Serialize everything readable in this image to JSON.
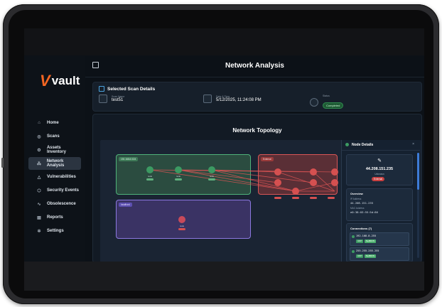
{
  "app": {
    "brand_mark": "V",
    "brand_word": "vault",
    "page_title": "Network Analysis"
  },
  "sidebar": {
    "items": [
      {
        "label": "Home",
        "icon": "home-icon",
        "glyph": "⌂"
      },
      {
        "label": "Scans",
        "icon": "scan-icon",
        "glyph": "◎"
      },
      {
        "label": "Assets Inventory",
        "icon": "gear-icon",
        "glyph": "⚙"
      },
      {
        "label": "Network Analysis",
        "icon": "network-icon",
        "glyph": "⁂",
        "active": true
      },
      {
        "label": "Vulnerabilities",
        "icon": "warning-icon",
        "glyph": "△"
      },
      {
        "label": "Security Events",
        "icon": "shield-icon",
        "glyph": "⬡"
      },
      {
        "label": "Obsolescence",
        "icon": "pulse-icon",
        "glyph": "∿"
      },
      {
        "label": "Reports",
        "icon": "report-icon",
        "glyph": "▤"
      },
      {
        "label": "Settings",
        "icon": "settings-icon",
        "glyph": "✲"
      }
    ]
  },
  "scan": {
    "title": "Selected Scan Details",
    "name_label": "Scan Name",
    "name_value": "test51",
    "date_label": "Date & Time",
    "date_value": "5/12/2025, 11:24:08 PM",
    "status_label": "Status",
    "status_value": "Completed"
  },
  "topology": {
    "title": "Network Topology",
    "groups": {
      "green": "192.168.8.0/24",
      "red": "External",
      "purple": "localhost"
    },
    "node_label": "node",
    "pill_green": "",
    "pill_red": ""
  },
  "details": {
    "title": "Node Details",
    "close": "×",
    "ip": "44.208.151.235",
    "type": "Unknown",
    "badge": "External",
    "overview_title": "Overview",
    "ip_label": "IP Address",
    "ip_value": "44.208.151.235",
    "mac_label": "MAC Address",
    "mac_value": "e0:38:03:55:5d:86",
    "connections_title": "Connections (7)",
    "connections": [
      {
        "ip": "192.168.8.255",
        "tags": [
          "UDP",
          "NetBIOS"
        ]
      },
      {
        "ip": "255.255.255.255",
        "tags": [
          "UDP",
          "NetBIOS"
        ]
      }
    ]
  },
  "colors": {
    "accent": "#f26522",
    "active": "#2b3440",
    "green": "#3c9a62",
    "red": "#d55050",
    "purple": "#8c78e0"
  }
}
